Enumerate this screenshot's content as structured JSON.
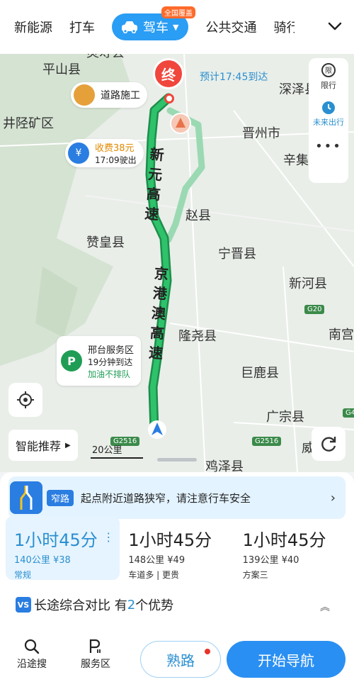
{
  "top_nav": {
    "tabs": [
      "新能源",
      "打车",
      "驾车",
      "公共交通",
      "骑行"
    ],
    "active_badge": "全国覆盖",
    "expand_icon": "chevron-down-icon"
  },
  "map": {
    "cities": [
      "灵寿县",
      "平山县",
      "井陉矿区",
      "深泽县",
      "晋州市",
      "辛集",
      "赵县",
      "赞皇县",
      "宁晋县",
      "新河县",
      "隆尧县",
      "南宫",
      "巨鹿县",
      "广宗县",
      "鸡泽县",
      "威县"
    ],
    "road_names": {
      "xinyuan": "新元高速",
      "jinggang": "京港澳高速"
    },
    "road_shields": [
      "G20",
      "G2516",
      "G2516",
      "G4"
    ],
    "end_marker": "终",
    "eta": "预计17:45到达",
    "construction": "道路施工",
    "toll": {
      "line1": "收费38元",
      "line2": "17:09驶出"
    },
    "service_area": {
      "name": "邢台服务区",
      "time": "19分钟到达",
      "note": "加油不排队"
    },
    "right_panel": {
      "restrict_label": "限行",
      "restrict_icon_text": "限",
      "future_label": "未来出行",
      "more": "•••"
    },
    "smart_recommend": "智能推荐",
    "scale": "20公里",
    "colors": {
      "route_main": "#1fb05a",
      "route_alt": "#9bd9b3",
      "accent": "#2a8fd0"
    }
  },
  "warning": {
    "tag": "窄路",
    "message": "起点附近道路狭窄，请注意行车安全"
  },
  "routes": [
    {
      "time": "1小时45分",
      "meta": "140公里 ¥38",
      "label": "常规"
    },
    {
      "time": "1小时45分",
      "meta": "148公里 ¥49",
      "label": "车道多 | 更贵"
    },
    {
      "time": "1小时45分",
      "meta": "139公里 ¥40",
      "label": "方案三"
    }
  ],
  "compare": {
    "prefix": "长途综合对比 有",
    "count": "2",
    "suffix": "个优势",
    "vs": "VS"
  },
  "bottom": {
    "along_search": "沿途搜",
    "service_area": "服务区",
    "familiar_road": "熟路",
    "start_navigation": "开始导航"
  }
}
